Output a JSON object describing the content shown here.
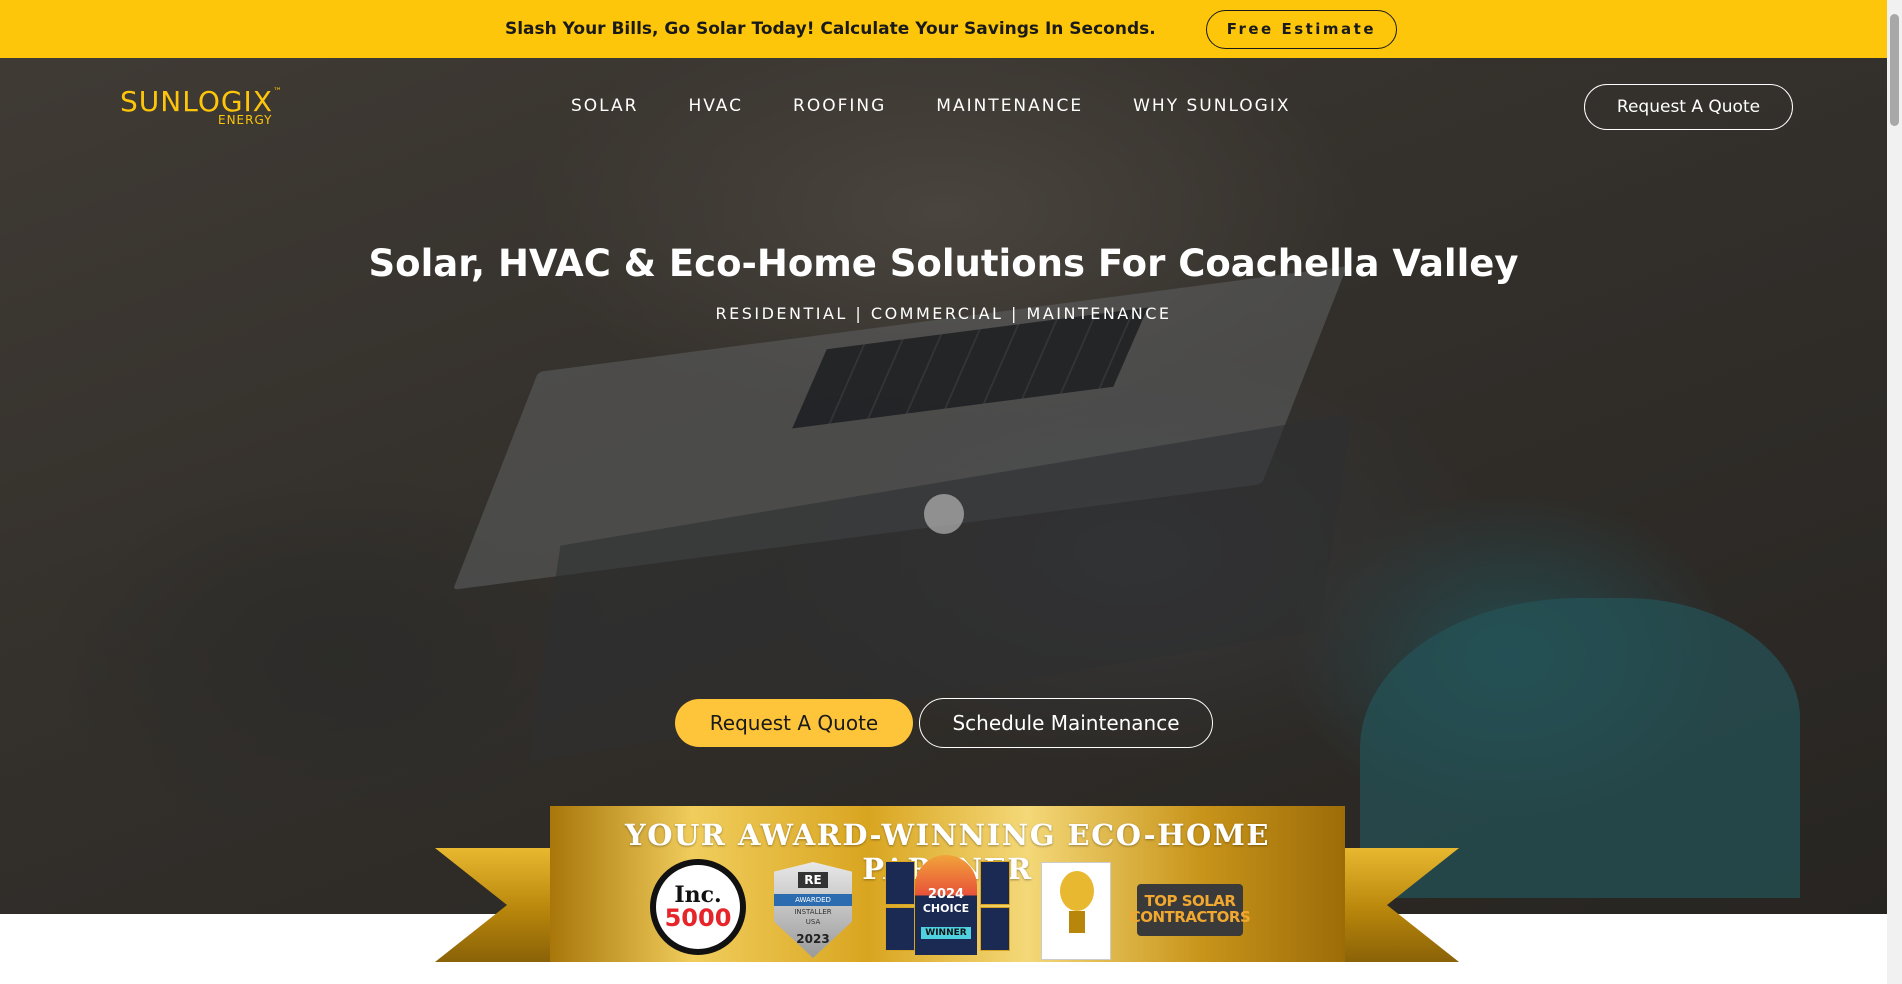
{
  "promo_bar": {
    "text": "Slash Your Bills, Go Solar Today! Calculate Your Savings In Seconds.",
    "button_label": "Free Estimate"
  },
  "logo": {
    "main": "SUNLOGIX",
    "tm": "™",
    "sub": "ENERGY"
  },
  "nav": {
    "items": [
      {
        "label": "SOLAR"
      },
      {
        "label": "HVAC"
      },
      {
        "label": "ROOFING"
      },
      {
        "label": "MAINTENANCE"
      },
      {
        "label": "WHY SUNLOGIX"
      }
    ],
    "quote_button": "Request A Quote"
  },
  "hero": {
    "title": "Solar, HVAC & Eco-Home Solutions For Coachella Valley",
    "subtitle": "RESIDENTIAL | COMMERCIAL | MAINTENANCE",
    "primary_cta": "Request A Quote",
    "secondary_cta": "Schedule Maintenance"
  },
  "awards": {
    "title": "YOUR AWARD-WINNING ECO-HOME PARTNER",
    "inc": {
      "top": "Inc.",
      "number": "5000"
    },
    "shield": {
      "re": "RE",
      "awarded": "AWARDED",
      "installer": "INSTALLER",
      "country": "USA",
      "year": "2023"
    },
    "choice": {
      "year": "2024",
      "word": "CHOICE",
      "winner": "WINNER"
    },
    "topsolar": {
      "line1": "TOP SOLAR",
      "line2": "CONTRACTORS"
    }
  },
  "colors": {
    "brand_yellow": "#fec60a",
    "cta_yellow": "#fec53a",
    "ribbon_gold": "#d9a520"
  },
  "icons": {
    "play": "play-dot-icon"
  }
}
